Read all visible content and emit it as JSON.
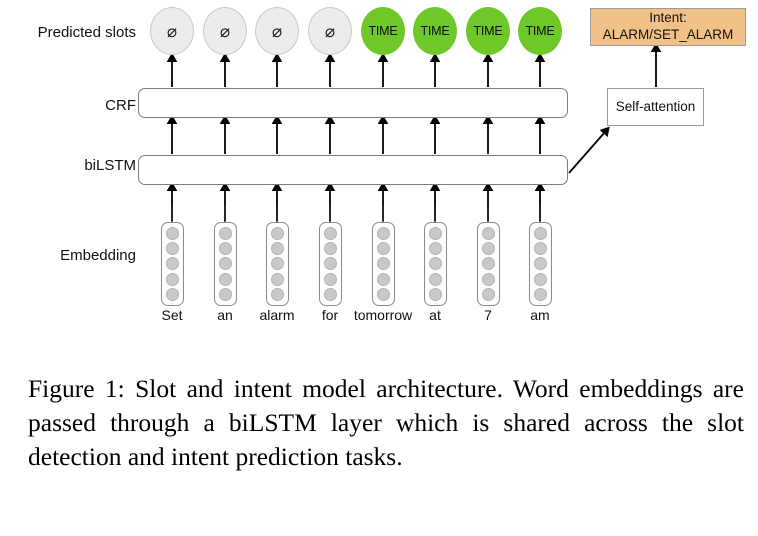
{
  "figure": {
    "row_labels": {
      "predicted_slots": "Predicted slots",
      "crf": "CRF",
      "bilstm": "biLSTM",
      "embedding": "Embedding"
    },
    "predicted_slots": [
      {
        "label": "⌀",
        "type": "null",
        "name": "slot-null-1"
      },
      {
        "label": "⌀",
        "type": "null",
        "name": "slot-null-2"
      },
      {
        "label": "⌀",
        "type": "null",
        "name": "slot-null-3"
      },
      {
        "label": "⌀",
        "type": "null",
        "name": "slot-null-4"
      },
      {
        "label": "TIME",
        "type": "time",
        "name": "slot-time-1"
      },
      {
        "label": "TIME",
        "type": "time",
        "name": "slot-time-2"
      },
      {
        "label": "TIME",
        "type": "time",
        "name": "slot-time-3"
      },
      {
        "label": "TIME",
        "type": "time",
        "name": "slot-time-4"
      }
    ],
    "tokens": [
      "Set",
      "an",
      "alarm",
      "for",
      "tomorrow",
      "at",
      "7",
      "am"
    ],
    "embedding_dims": 5,
    "intent_box": {
      "title": "Intent:",
      "value": "ALARM/SET_ALARM"
    },
    "self_attention_label": "Self-attention",
    "colors": {
      "time_slot_fill": "#6ec82a",
      "null_slot_fill": "#ececec",
      "intent_fill": "#f2c187",
      "embedding_dot": "#c9c9c9",
      "box_stroke": "#7d7d7d",
      "arrow": "#000000"
    }
  },
  "caption": "Figure 1: Slot and intent model architecture. Word embeddings are passed through a biLSTM layer which is shared across the slot detection and intent prediction tasks."
}
